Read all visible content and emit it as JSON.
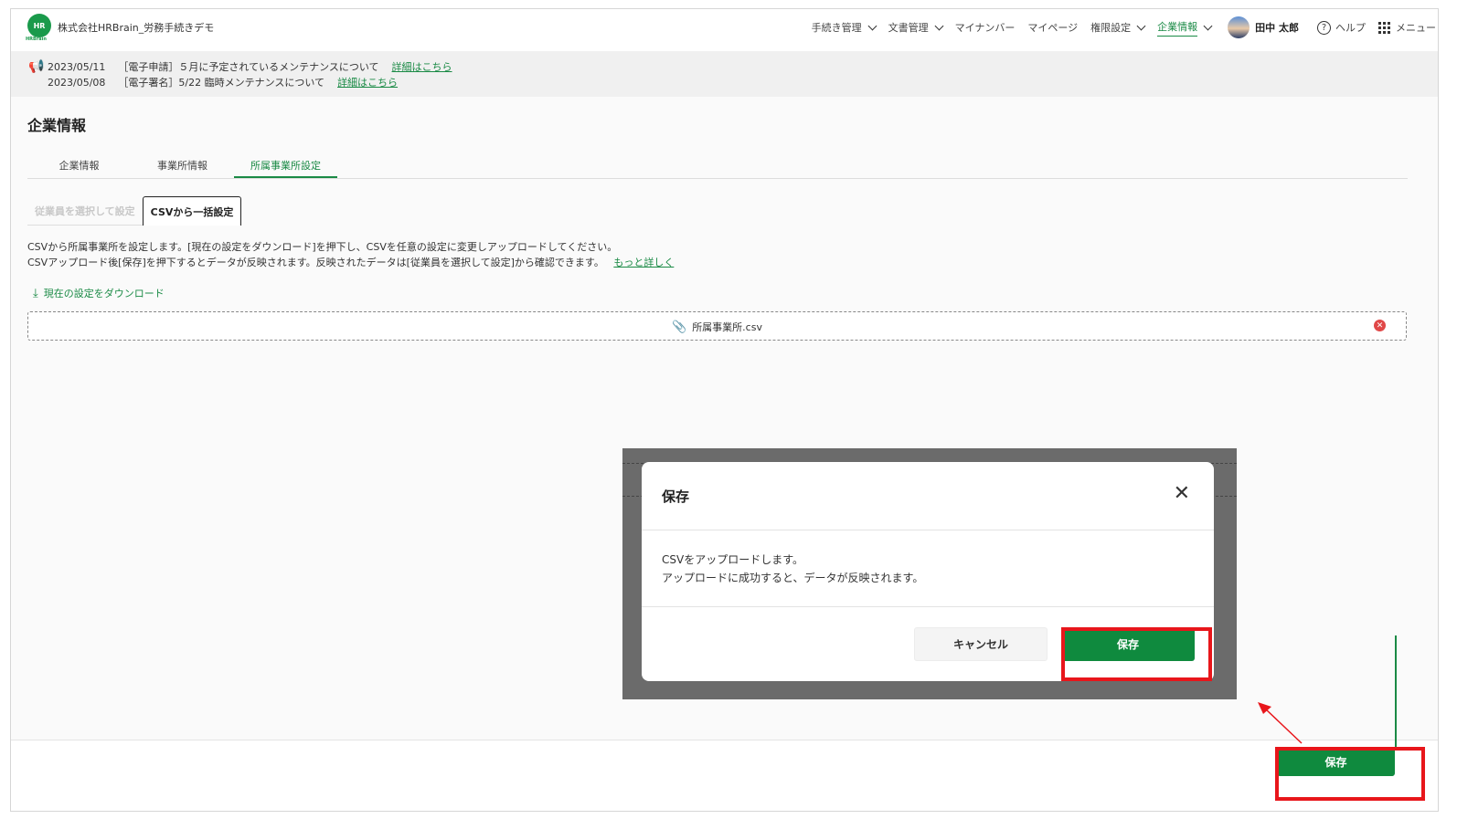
{
  "header": {
    "logo_text": "HR",
    "logo_sub": "HRBrain",
    "company": "株式会社HRBrain_労務手続きデモ",
    "nav": [
      {
        "label": "手続き管理",
        "chevron": true,
        "active": false
      },
      {
        "label": "文書管理",
        "chevron": true,
        "active": false
      },
      {
        "label": "マイナンバー",
        "chevron": false,
        "active": false
      },
      {
        "label": "マイページ",
        "chevron": false,
        "active": false
      },
      {
        "label": "権限設定",
        "chevron": true,
        "active": false
      },
      {
        "label": "企業情報",
        "chevron": true,
        "active": true
      }
    ],
    "user_name": "田中 太郎",
    "help_label": "ヘルプ",
    "menu_label": "メニュー"
  },
  "notices": [
    {
      "date": "2023/05/11",
      "text": "［電子申請］５月に予定されているメンテナンスについて",
      "link": "詳細はこちら"
    },
    {
      "date": "2023/05/08",
      "text": "［電子署名］5/22 臨時メンテナンスについて",
      "link": "詳細はこちら"
    }
  ],
  "page": {
    "title": "企業情報",
    "tabs": [
      "企業情報",
      "事業所情報",
      "所属事業所設定"
    ],
    "subtabs": [
      "従業員を選択して設定",
      "CSVから一括設定"
    ],
    "desc_line1": "CSVから所属事業所を設定します。[現在の設定をダウンロード]を押下し、CSVを任意の設定に変更しアップロードしてください。",
    "desc_line2": "CSVアップロード後[保存]を押下するとデータが反映されます。反映されたデータは[従業員を選択して設定]から確認できます。",
    "more_link": "もっと詳しく",
    "download_label": "現在の設定をダウンロード",
    "file_name": "所属事業所.csv",
    "save_label": "保存"
  },
  "modal": {
    "title": "保存",
    "body_line1": "CSVをアップロードします。",
    "body_line2": "アップロードに成功すると、データが反映されます。",
    "cancel_label": "キャンセル",
    "save_label": "保存"
  },
  "colors": {
    "accent": "#0f8a3e",
    "highlight": "#e8161b"
  }
}
